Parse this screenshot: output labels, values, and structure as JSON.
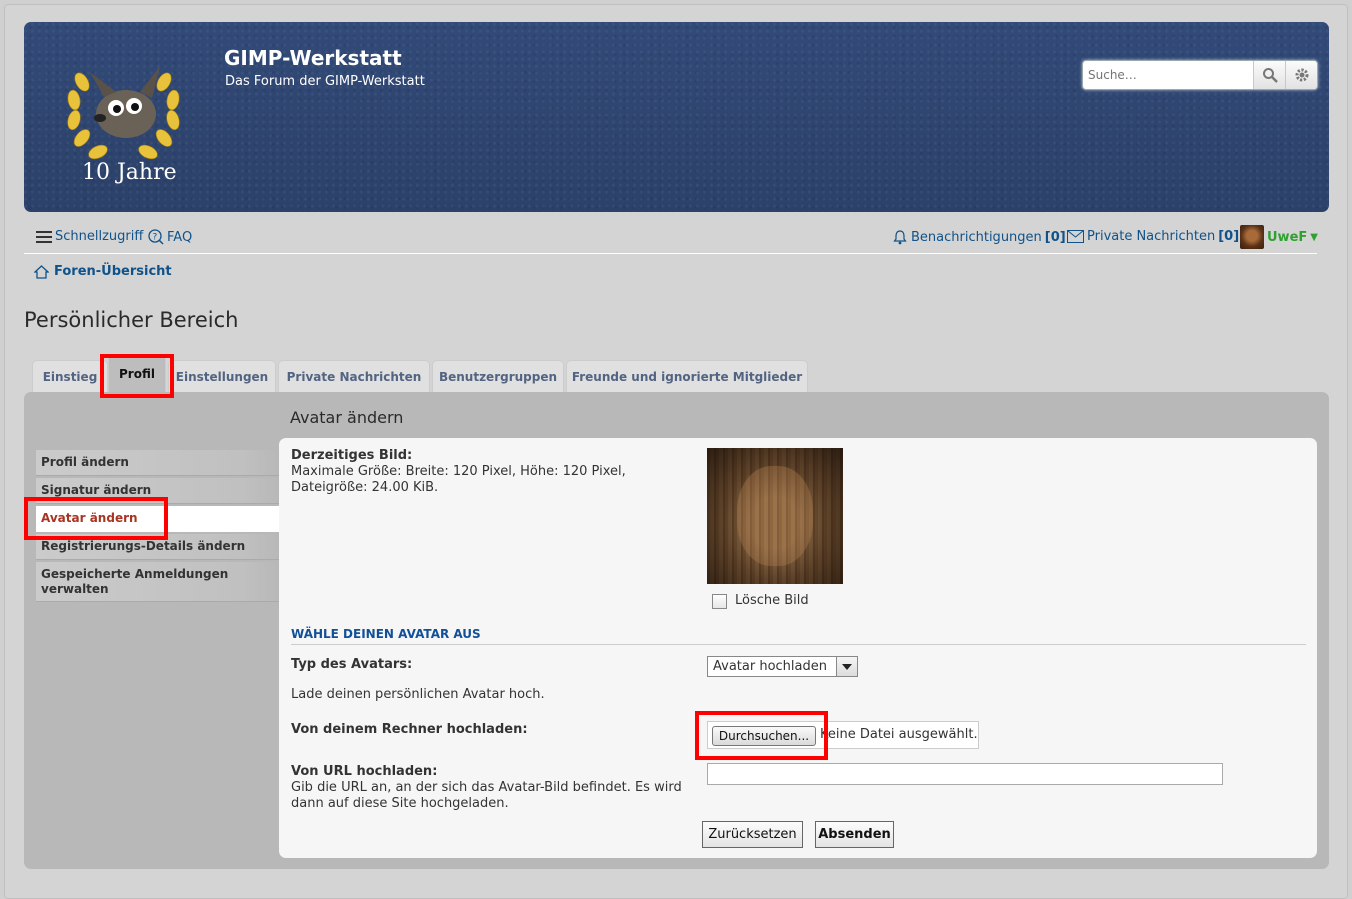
{
  "header": {
    "site_title": "GIMP-Werkstatt",
    "site_description": "Das Forum der GIMP-Werkstatt",
    "logo_text": "10 Jahre",
    "search_placeholder": "Suche…",
    "search_icon": "search-icon",
    "advanced_search_icon": "gear-icon"
  },
  "navbar": {
    "quicklinks_label": "Schnellzugriff",
    "faq_label": "FAQ",
    "notifications_label": "Benachrichtigungen",
    "notifications_count": "[0]",
    "pm_label": "Private Nachrichten",
    "pm_count": "[0]",
    "username": "UweF",
    "breadcrumb_label": "Foren-Übersicht"
  },
  "page_title": "Persönlicher Bereich",
  "tabs": [
    {
      "label": "Einstieg",
      "active": false
    },
    {
      "label": "Profil",
      "active": true
    },
    {
      "label": "Einstellungen",
      "active": false
    },
    {
      "label": "Private Nachrichten",
      "active": false
    },
    {
      "label": "Benutzergruppen",
      "active": false
    },
    {
      "label": "Freunde und ignorierte Mitglieder",
      "active": false
    }
  ],
  "sidebar": {
    "items": [
      {
        "label": "Profil ändern",
        "active": false
      },
      {
        "label": "Signatur ändern",
        "active": false
      },
      {
        "label": "Avatar ändern",
        "active": true
      },
      {
        "label": "Registrierungs-Details ändern",
        "active": false
      },
      {
        "label": "Gespeicherte Anmeldungen verwalten",
        "active": false
      }
    ]
  },
  "panel": {
    "title": "Avatar ändern",
    "current_label": "Derzeitiges Bild:",
    "current_hint": "Maximale Größe: Breite: 120 Pixel, Höhe: 120 Pixel, Dateigröße: 24.00 KiB.",
    "delete_label": "Lösche Bild",
    "section_heading": "Wähle deinen Avatar aus",
    "type_label": "Typ des Avatars:",
    "type_value": "Avatar hochladen",
    "upload_hint": "Lade deinen persönlichen Avatar hoch.",
    "upload_label": "Von deinem Rechner hochladen:",
    "browse_label": "Durchsuchen...",
    "no_file_text": "Keine Datei ausgewählt.",
    "url_label": "Von URL hochladen:",
    "url_hint": "Gib die URL an, an der sich das Avatar-Bild befindet. Es wird dann auf diese Site hochgeladen.",
    "url_value": "",
    "reset_label": "Zurücksetzen",
    "submit_label": "Absenden"
  },
  "colors": {
    "header_bg": "#2f4672",
    "link": "#105289",
    "username": "#2ea12e",
    "highlight": "#ff0000",
    "section_heading": "#115098"
  }
}
